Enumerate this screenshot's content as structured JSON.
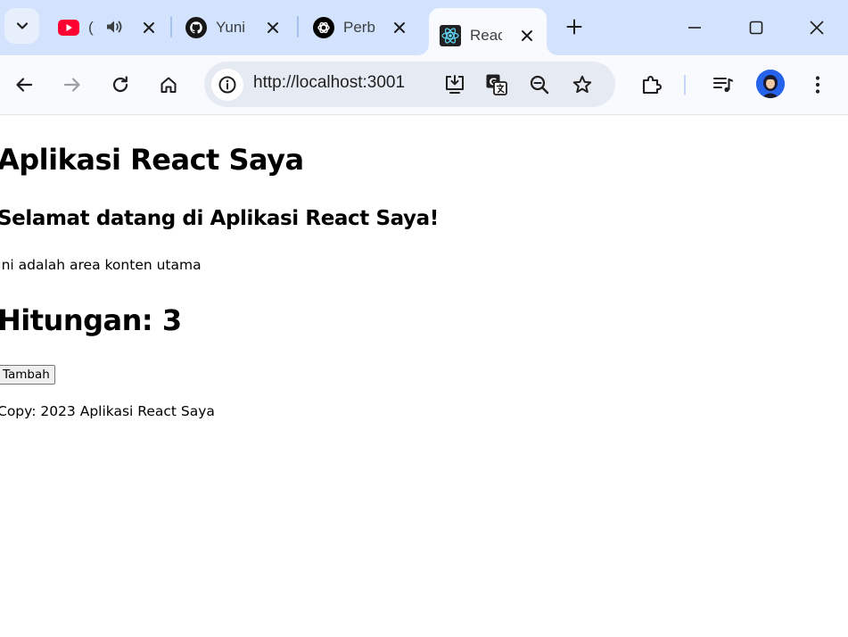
{
  "browser": {
    "tabs": [
      {
        "title": "(",
        "favicon": "youtube-icon",
        "audio": true
      },
      {
        "title": "Yuni",
        "favicon": "github-icon"
      },
      {
        "title": "Perb",
        "favicon": "openai-icon"
      },
      {
        "title": "Reac",
        "favicon": "react-icon",
        "active": true
      }
    ],
    "address_bar": {
      "url": "http://localhost:3001"
    },
    "colors": {
      "frame": "#d3e3fd",
      "toolbar": "#f8fafe",
      "omnibox": "#e6ebf3",
      "youtube_red": "#ff0033",
      "react_cyan": "#61dafb"
    }
  },
  "page": {
    "app_title": "Aplikasi React Saya",
    "welcome_heading": "Selamat datang di Aplikasi React Saya!",
    "content_text": "Ini adalah area konten utama",
    "counter_label": "Hitungan: 3",
    "add_button": "Tambah",
    "footer_text": "Copy: 2023 Aplikasi React Saya"
  }
}
